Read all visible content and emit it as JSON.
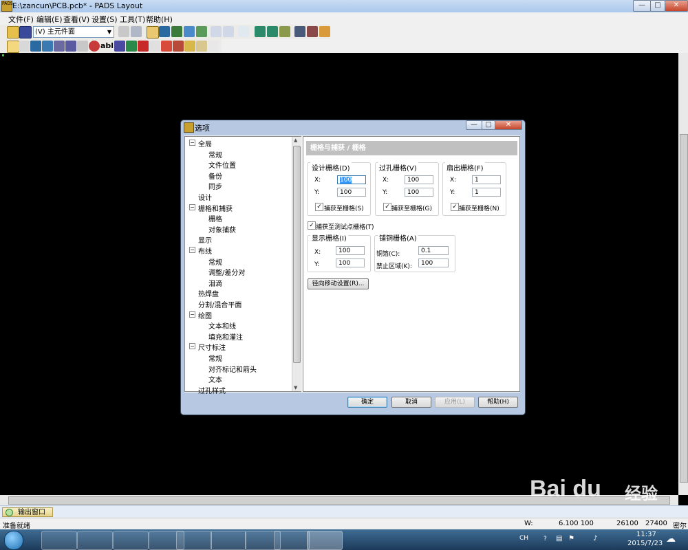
{
  "window": {
    "title": "E:\\zancun\\PCB.pcb* - PADS Layout"
  },
  "menu": [
    "文件(F)",
    "编辑(E)",
    "查看(V)",
    "设置(S)",
    "工具(T)",
    "帮助(H)"
  ],
  "toolbar": {
    "mode_combo": "(V) 主元件面"
  },
  "dialog": {
    "title": "选项",
    "tree": [
      {
        "label": "全局",
        "level": 0,
        "expanded": true
      },
      {
        "label": "常规",
        "level": 1
      },
      {
        "label": "文件位置",
        "level": 1
      },
      {
        "label": "备份",
        "level": 1
      },
      {
        "label": "同步",
        "level": 1
      },
      {
        "label": "设计",
        "level": 0
      },
      {
        "label": "栅格和捕获",
        "level": 0,
        "expanded": true
      },
      {
        "label": "栅格",
        "level": 1
      },
      {
        "label": "对象捕获",
        "level": 1
      },
      {
        "label": "显示",
        "level": 0
      },
      {
        "label": "布线",
        "level": 0,
        "expanded": true
      },
      {
        "label": "常规",
        "level": 1
      },
      {
        "label": "调整/差分对",
        "level": 1
      },
      {
        "label": "泪滴",
        "level": 1
      },
      {
        "label": "热焊盘",
        "level": 0
      },
      {
        "label": "分割/混合平面",
        "level": 0
      },
      {
        "label": "绘图",
        "level": 0,
        "expanded": true
      },
      {
        "label": "文本和线",
        "level": 1
      },
      {
        "label": "填充和灌注",
        "level": 1
      },
      {
        "label": "尺寸标注",
        "level": 0,
        "expanded": true
      },
      {
        "label": "常规",
        "level": 1
      },
      {
        "label": "对齐标记和箭头",
        "level": 1
      },
      {
        "label": "文本",
        "level": 1
      },
      {
        "label": "过孔样式",
        "level": 0
      }
    ],
    "pane_title": "栅格与捕获 / 栅格",
    "design_grid": {
      "legend": "设计栅格(D)",
      "x_label": "X:",
      "y_label": "Y:",
      "x": "100",
      "y": "100",
      "snap_label": "捕获至栅格(S)",
      "snap": true
    },
    "via_grid": {
      "legend": "过孔栅格(V)",
      "x_label": "X:",
      "y_label": "Y:",
      "x": "100",
      "y": "100",
      "snap_label": "捕获至栅格(G)",
      "snap": true
    },
    "fanout_grid": {
      "legend": "扇出栅格(F)",
      "x_label": "X:",
      "y_label": "Y:",
      "x": "1",
      "y": "1",
      "snap_label": "捕获至栅格(N)",
      "snap": true
    },
    "test_point": {
      "label": "捕获至测试点栅格(T)",
      "checked": true
    },
    "display_grid": {
      "legend": "显示栅格(I)",
      "x_label": "X:",
      "y_label": "Y:",
      "x": "100",
      "y": "100"
    },
    "pour_grid": {
      "legend": "铺铜栅格(A)",
      "copper_label": "铜箔(C):",
      "copper": "0.1",
      "keepout_label": "禁止区域(K):",
      "keepout": "100"
    },
    "radial_button": "径向移动设置(R)...",
    "buttons": {
      "ok": "确定",
      "cancel": "取消",
      "apply": "应用(L)",
      "help": "帮助(H)"
    }
  },
  "output_tab": "输出窗口",
  "status": {
    "text": "准备就绪",
    "w_label": "W:",
    "w_value": "6.100 100",
    "x_value": "26100",
    "y_value": "27400",
    "units": "密尔"
  },
  "taskbar": {
    "lang": "CH",
    "time": "11:37",
    "date": "2015/7/23"
  },
  "colors": {
    "canvas": "#000000",
    "titlebar": "#b8d1ef",
    "pane_header": "#c0c0c0",
    "selection": "#3399ff",
    "taskbar": "#2b4f72"
  },
  "watermark": "Baidu 经验 jingyan.baidu.com"
}
